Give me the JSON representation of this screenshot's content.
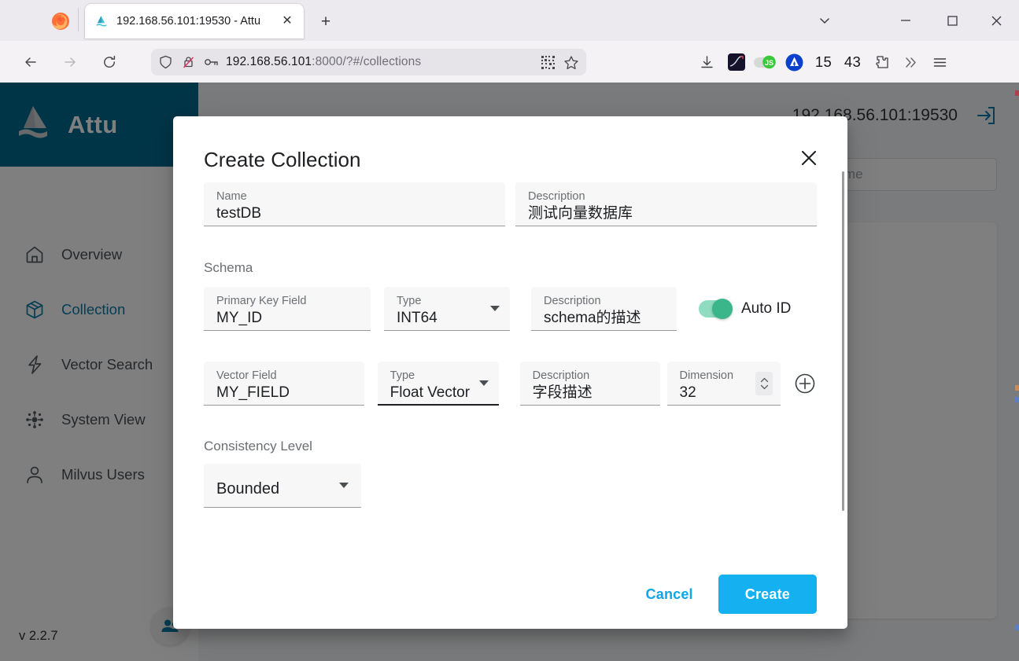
{
  "browser": {
    "tab": {
      "title": "192.168.56.101:19530 - Attu",
      "favicon": "attu-sail-icon",
      "close": "✕"
    },
    "newtab_label": "+",
    "url": {
      "host": "192.168.56.101",
      "rest": ":8000/?#/collections"
    },
    "toolbar_numbers": [
      "15",
      "43"
    ],
    "window_controls": {
      "minimize": "—",
      "maximize": "□",
      "close": "✕"
    }
  },
  "sidebar": {
    "brand": "Attu",
    "version": "v 2.2.7",
    "items": [
      {
        "label": "Overview",
        "icon": "home-icon",
        "active": false
      },
      {
        "label": "Collection",
        "icon": "box-icon",
        "active": true
      },
      {
        "label": "Vector Search",
        "icon": "bolt-icon",
        "active": false
      },
      {
        "label": "System View",
        "icon": "network-icon",
        "active": false
      },
      {
        "label": "Milvus Users",
        "icon": "person-icon",
        "active": false
      }
    ]
  },
  "content": {
    "address": "192.168.56.101:19530",
    "logout_icon": "logout-icon",
    "search_placeholder": "name"
  },
  "modal": {
    "title": "Create Collection",
    "close_label": "✕",
    "name": {
      "label": "Name",
      "value": "testDB"
    },
    "description": {
      "label": "Description",
      "value": "测试向量数据库"
    },
    "schema_label": "Schema",
    "primary_row": {
      "field": {
        "label": "Primary Key Field",
        "value": "MY_ID"
      },
      "type": {
        "label": "Type",
        "value": "INT64"
      },
      "description": {
        "label": "Description",
        "value": "schema的描述"
      },
      "auto_id": {
        "label": "Auto ID",
        "enabled": true
      }
    },
    "vector_row": {
      "field": {
        "label": "Vector Field",
        "value": "MY_FIELD"
      },
      "type": {
        "label": "Type",
        "value": "Float Vector",
        "focused": true
      },
      "description": {
        "label": "Description",
        "value": "字段描述"
      },
      "dimension": {
        "label": "Dimension",
        "value": "32"
      },
      "add_icon": "plus-circle-icon"
    },
    "consistency": {
      "label": "Consistency Level",
      "value": "Bounded"
    },
    "cancel_label": "Cancel",
    "create_label": "Create"
  },
  "colors": {
    "brand": "#006b8f",
    "accent": "#0b7aa8",
    "primary_button": "#14b0f0",
    "link": "#0ea5e9",
    "toggle_on": "#3bb68a"
  }
}
